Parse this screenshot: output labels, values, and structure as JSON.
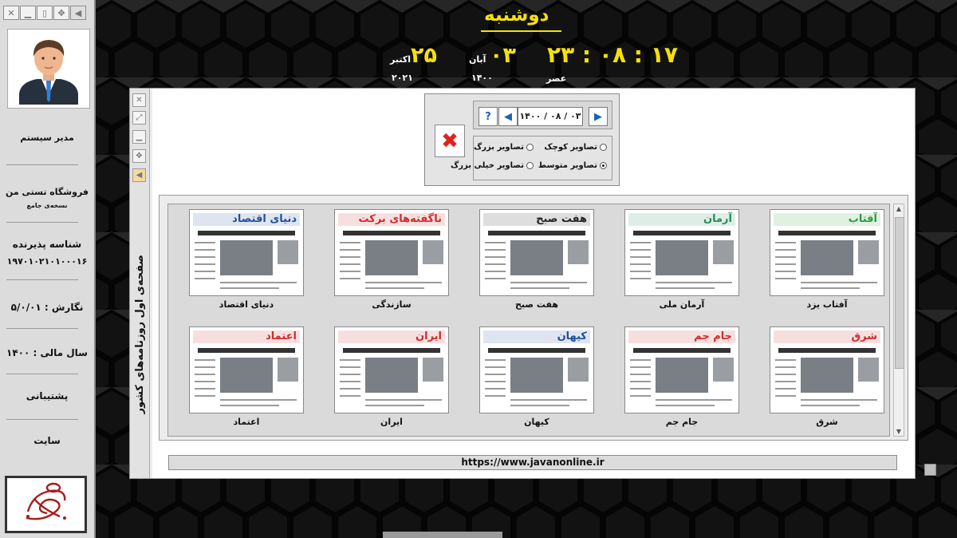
{
  "window_controls": [
    "close-icon",
    "minimize-icon",
    "restore-icon",
    "move-icon",
    "play-icon"
  ],
  "sidebar": {
    "user_name": "مدیر سیستم",
    "store_name": "فروشگاه تستی من",
    "edition": "نسخه‌ی جامع",
    "receiver_label": "شناسه پذیرنده",
    "receiver_id": "۱۹۷۰۱۰۲۱۰۱۰۰۰۱۶",
    "version": "نگارش : ۵/۰/۰۱",
    "fiscal_year": "سال مالی : ۱۴۰۰",
    "support": "پشتیبانی",
    "site": "سایت"
  },
  "clock": {
    "weekday": "دوشنبه",
    "time": "۲۳ : ۰۸ : ۱۷",
    "period": "عصر",
    "jalali_day": "۰۳",
    "jalali_month": "آبان",
    "jalali_year": "۱۴۰۰",
    "greg_day": "۲۵",
    "greg_month": "اکتبر",
    "greg_year": "۲۰۲۱"
  },
  "panel": {
    "side_title": "صفحه‌ی اول روزنامه‌های کشور",
    "date": "۱۴۰۰ / ۰۸ / ۰۳",
    "help_label": "?",
    "options": {
      "small": "تصاویر کوچک",
      "large": "تصاویر بزرگ",
      "medium": "تصاویر متوسط",
      "xlarge": "تصاویر خیلی بزرگ"
    },
    "url": "https://www.javanonline.ir"
  },
  "papers": [
    {
      "name": "آفتاب یزد",
      "masthead": "آفتاب",
      "color": "#2e9a3c"
    },
    {
      "name": "آرمان ملی",
      "masthead": "آرمان",
      "color": "#1f8f57"
    },
    {
      "name": "هفت صبح",
      "masthead": "هفت صبح",
      "color": "#222222"
    },
    {
      "name": "سازندگی",
      "masthead": "ناگفته‌های برکت",
      "color": "#d12a2a"
    },
    {
      "name": "دنیای اقتصاد",
      "masthead": "دنیای اقتصاد",
      "color": "#1f4f9e"
    },
    {
      "name": "شرق",
      "masthead": "شرق",
      "color": "#d12a2a"
    },
    {
      "name": "جام جم",
      "masthead": "جام جم",
      "color": "#d12a2a"
    },
    {
      "name": "کیهان",
      "masthead": "کیهان",
      "color": "#1f4f9e"
    },
    {
      "name": "ایران",
      "masthead": "ایران",
      "color": "#d12a2a"
    },
    {
      "name": "اعتماد",
      "masthead": "اعتماد",
      "color": "#d12a2a"
    }
  ]
}
